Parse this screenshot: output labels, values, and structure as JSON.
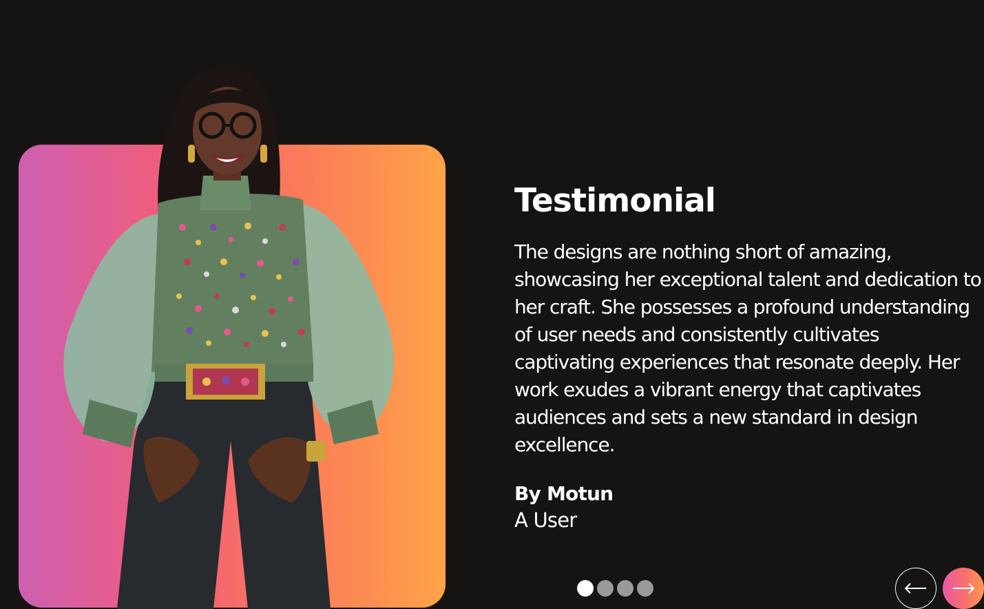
{
  "testimonial": {
    "title": "Testimonial",
    "quote": "The designs are nothing short of amazing, showcasing her exceptional talent and dedication to her craft. She possesses a profound understanding of user needs and consistently cultivates captivating experiences that resonate deeply. Her work exudes a vibrant energy that captivates audiences and sets a new standard in design excellence.",
    "author": "By Motun",
    "role": "A User"
  },
  "carousel": {
    "slide_count": 4,
    "active_index": 0,
    "prev_icon": "arrow-left-icon",
    "next_icon": "arrow-right-icon"
  },
  "colors": {
    "background": "#161413",
    "text": "#ffffff",
    "dot_active": "#ffffff",
    "dot_inactive": "#9a9a9a",
    "gradient_start": "#cd5fb2",
    "gradient_mid": "#f25d7a",
    "gradient_end": "#fea348"
  }
}
